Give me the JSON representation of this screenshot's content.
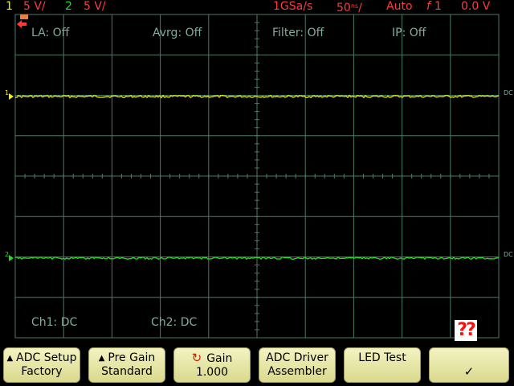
{
  "top_bar": {
    "ch1_num": "1",
    "ch1_scale": "5 V/",
    "ch2_num": "2",
    "ch2_scale": "5 V/",
    "sample_rate": "1GSa/s",
    "timebase": "50",
    "timebase_unit": "ns",
    "trigger_mode": "Auto",
    "trigger_symbol": "f",
    "trigger_source": "1",
    "trigger_level": "0.0 V"
  },
  "status_labels": {
    "la": "LA: Off",
    "avrg": "Avrg: Off",
    "filter": "Filter: Off",
    "ip": "IP: Off",
    "ch1_coupling": "Ch1: DC",
    "ch2_coupling": "Ch2: DC"
  },
  "markers": {
    "ch1_marker": "1",
    "ch2_marker": "2",
    "ch1_dc": "DC",
    "ch2_dc": "DC"
  },
  "badge": "??",
  "softkeys": [
    {
      "line1": "ADC Setup",
      "line2": "Factory"
    },
    {
      "line1": "Pre Gain",
      "line2": "Standard"
    },
    {
      "line1": "Gain",
      "line2": "1.000"
    },
    {
      "line1": "ADC Driver",
      "line2": "Assembler"
    },
    {
      "line1": "LED Test",
      "line2": ""
    },
    {
      "line1": "",
      "line2": "✓"
    }
  ],
  "colors": {
    "ch1": "#f2f200",
    "ch2": "#1ee01e",
    "trigger": "#ff3a3a",
    "grid": "#4a7a6a"
  }
}
